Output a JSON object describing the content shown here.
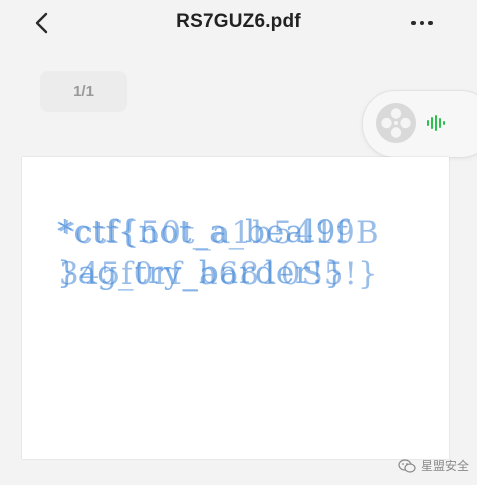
{
  "header": {
    "title": "RS7GUZ6.pdf"
  },
  "page_indicator": "1/1",
  "document": {
    "flag_line1_a": "*ctf{not_a_beal9f",
    "flag_line1_b": "*ctf{50t_a1b5419B",
    "flag_line2_a": "}ag_try_barder!}",
    "flag_line2_b": "345f0rf_a6810S5!}"
  },
  "watermark": {
    "label": "星盟安全"
  },
  "colors": {
    "flag_text": "#5f9be0",
    "audio_icon": "#2bbf4e"
  }
}
